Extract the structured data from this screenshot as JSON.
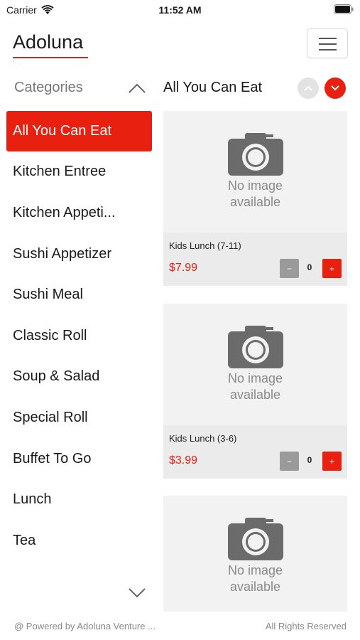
{
  "status_bar": {
    "carrier": "Carrier",
    "time": "11:52 AM"
  },
  "header": {
    "brand": "Adoluna"
  },
  "sidebar": {
    "heading": "Categories",
    "items": [
      {
        "label": "All You Can Eat",
        "active": true
      },
      {
        "label": "Kitchen Entree"
      },
      {
        "label": "Kitchen Appeti..."
      },
      {
        "label": "Sushi Appetizer"
      },
      {
        "label": "Sushi Meal"
      },
      {
        "label": "Classic Roll"
      },
      {
        "label": "Soup & Salad"
      },
      {
        "label": "Special Roll"
      },
      {
        "label": "Buffet To Go"
      },
      {
        "label": "Lunch"
      },
      {
        "label": "Tea"
      }
    ]
  },
  "main": {
    "title": "All You Can Eat",
    "products": [
      {
        "placeholder_line1": "No image",
        "placeholder_line2": "available",
        "name": "Kids Lunch (7-11)",
        "price": "$7.99",
        "qty": "0",
        "minus": "−",
        "plus": "+"
      },
      {
        "placeholder_line1": "No image",
        "placeholder_line2": "available",
        "name": "Kids Lunch (3-6)",
        "price": "$3.99",
        "qty": "0",
        "minus": "−",
        "plus": "+"
      },
      {
        "placeholder_line1": "No image",
        "placeholder_line2": "available"
      }
    ]
  },
  "footer": {
    "left": "@ Powered by Adoluna Venture ...",
    "right": "All Rights Reserved"
  },
  "colors": {
    "accent": "#e8200f",
    "card_bg": "#f2f2f2",
    "muted": "#888888"
  }
}
